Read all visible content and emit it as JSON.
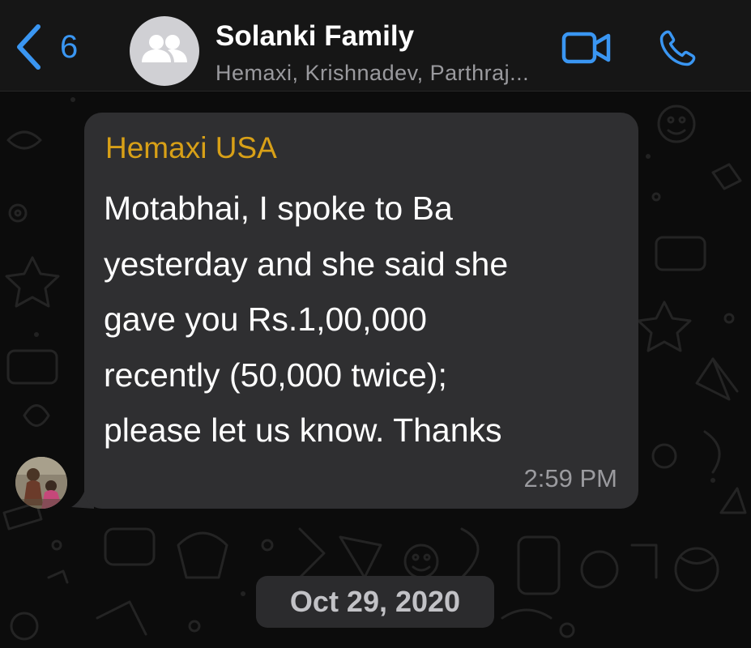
{
  "header": {
    "back_count": "6",
    "title": "Solanki Family",
    "subtitle": "Hemaxi, Krishnadev, Parthraj...",
    "accent_color": "#3a96f2",
    "icons": {
      "back": "chevron-left-icon",
      "group": "group-people-icon",
      "video": "video-camera-icon",
      "call": "phone-icon"
    }
  },
  "message": {
    "sender": "Hemaxi USA",
    "sender_color": "#d8a017",
    "lines": [
      "Motabhai, I spoke to Ba",
      "yesterday and she said she",
      "gave you Rs.1,00,000",
      "recently (50,000 twice);",
      "please let us know. Thanks"
    ],
    "time": "2:59 PM"
  },
  "date_separator": "Oct 29, 2020"
}
